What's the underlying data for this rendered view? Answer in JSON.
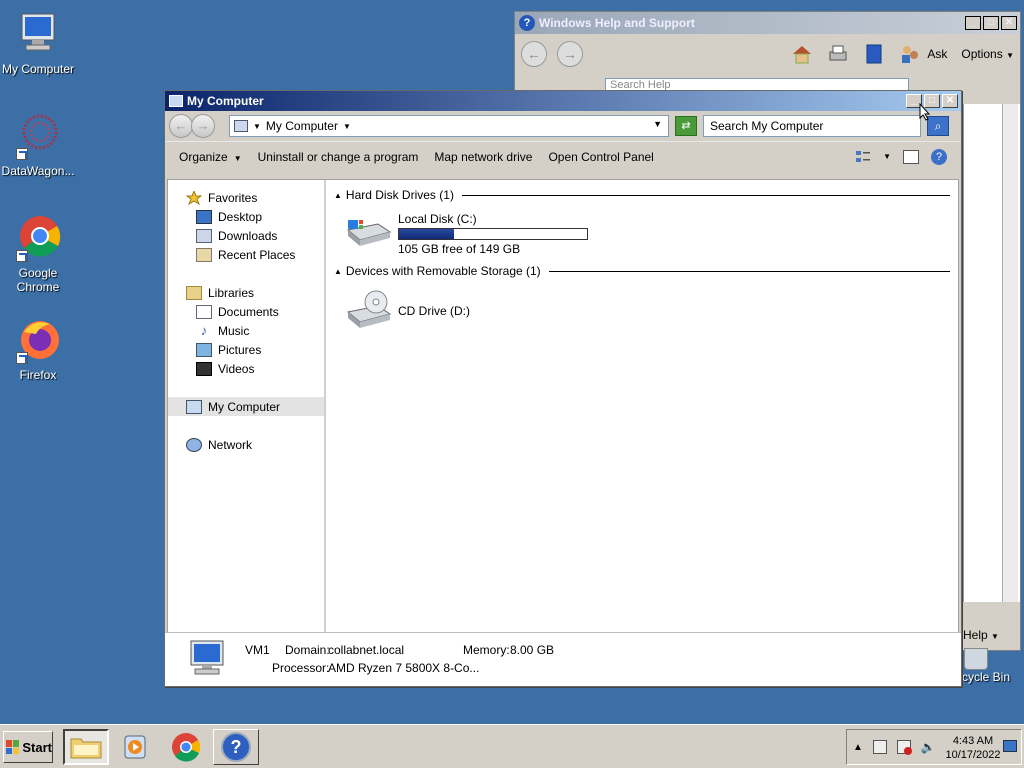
{
  "desktop": {
    "icons": [
      {
        "label": "My Computer"
      },
      {
        "label": "DataWagon..."
      },
      {
        "label": "Google Chrome"
      },
      {
        "label": "Firefox"
      }
    ],
    "recycle_bin_label": "cycle Bin"
  },
  "help_window": {
    "title": "Windows Help and Support",
    "ask_label": "Ask",
    "options_label": "Options",
    "search_placeholder": "Search Help",
    "help_menu_label": "Help"
  },
  "explorer": {
    "title": "My Computer",
    "address": "My Computer",
    "search_placeholder": "Search My Computer",
    "commands": {
      "organize": "Organize",
      "uninstall": "Uninstall or change a program",
      "map_drive": "Map network drive",
      "control_panel": "Open Control Panel"
    },
    "nav": {
      "favorites": "Favorites",
      "desktop": "Desktop",
      "downloads": "Downloads",
      "recent": "Recent Places",
      "libraries": "Libraries",
      "documents": "Documents",
      "music": "Music",
      "pictures": "Pictures",
      "videos": "Videos",
      "computer": "My Computer",
      "network": "Network"
    },
    "groups": {
      "hdd": "Hard Disk Drives (1)",
      "removable": "Devices with Removable Storage (1)"
    },
    "drives": {
      "c_name": "Local Disk (C:)",
      "c_free": "105 GB free of 149 GB",
      "c_used_fraction": 0.295,
      "d_name": "CD Drive (D:)"
    },
    "details": {
      "name": "VM1",
      "domain_label": "Domain:",
      "domain": "collabnet.local",
      "memory_label": "Memory:",
      "memory": "8.00 GB",
      "processor_label": "Processor:",
      "processor": "AMD Ryzen 7 5800X 8-Co..."
    }
  },
  "taskbar": {
    "start_label": "Start",
    "time": "4:43 AM",
    "date": "10/17/2022"
  },
  "colors": {
    "desktop": "#3b6fa6",
    "title_active_start": "#0a246a",
    "title_active_end": "#a6caf0",
    "drive_bar": "#1d3a8c"
  }
}
